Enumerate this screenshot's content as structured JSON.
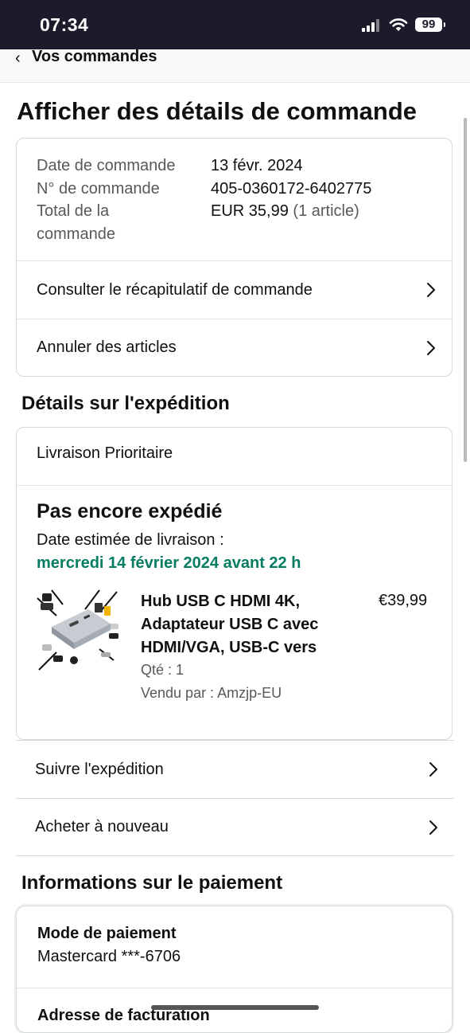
{
  "status_bar": {
    "time": "07:34",
    "battery": "99"
  },
  "nav": {
    "back_label": "Vos commandes"
  },
  "page": {
    "title": "Afficher des détails de commande"
  },
  "order_summary": {
    "date_label": "Date de commande",
    "date_value": "13 févr. 2024",
    "number_label": "N° de commande",
    "number_value": "405-0360172-6402775",
    "total_label_line1": "Total de la",
    "total_label_line2": "commande",
    "total_value": "EUR 35,99",
    "total_items": "(1 article)",
    "rows": [
      {
        "label": "Consulter le récapitulatif de commande"
      },
      {
        "label": "Annuler des articles"
      }
    ]
  },
  "shipping": {
    "heading": "Détails sur l'expédition",
    "method": "Livraison Prioritaire",
    "status": "Pas encore expédié",
    "delivery_label": "Date estimée de livraison :",
    "delivery_date": "mercredi 14 février 2024 avant 22 h",
    "product": {
      "title": "Hub USB C HDMI 4K, Adaptateur USB C avec HDMI/VGA, USB-C vers",
      "price": "€39,99",
      "quantity": "Qté : 1",
      "seller": "Vendu par : Amzjp-EU"
    },
    "actions": [
      {
        "label": "Suivre l'expédition"
      },
      {
        "label": "Acheter à nouveau"
      }
    ]
  },
  "payment": {
    "heading": "Informations sur le paiement",
    "method_label": "Mode de paiement",
    "method_value": "Mastercard  ***-6706",
    "billing_label": "Adresse de facturation"
  },
  "colors": {
    "status_bar_bg": "#1b1b2b",
    "delivery_green": "#067d62",
    "text_primary": "#0f1111",
    "text_secondary": "#565959"
  }
}
